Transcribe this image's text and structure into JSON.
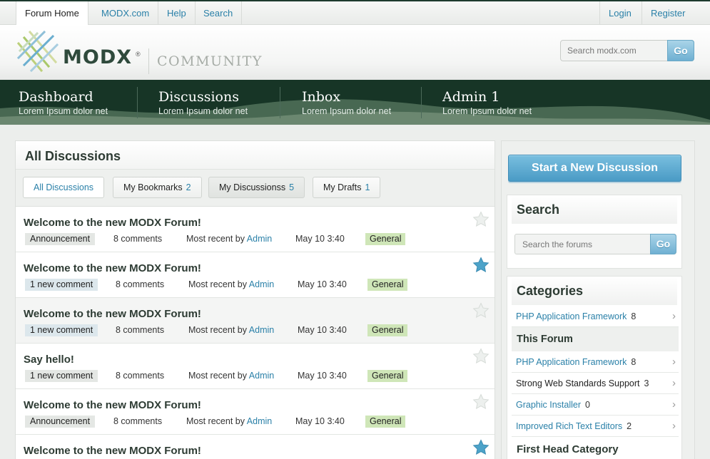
{
  "topbar": {
    "tabs": [
      "Forum Home",
      "MODX.com",
      "Help",
      "Search"
    ],
    "login": "Login",
    "register": "Register"
  },
  "logo": {
    "brand": "MODX",
    "reg": "®",
    "community": "COMMUNITY"
  },
  "header_search": {
    "placeholder": "Search modx.com",
    "go": "Go"
  },
  "nav": [
    {
      "title": "Dashboard",
      "sub": "Lorem Ipsum dolor net"
    },
    {
      "title": "Discussions",
      "sub": "Lorem Ipsum dolor net"
    },
    {
      "title": "Inbox",
      "sub": "Lorem Ipsum dolor net"
    },
    {
      "title": "Admin 1",
      "sub": "Lorem Ipsum dolor net"
    }
  ],
  "main": {
    "title": "All Discussions",
    "filters": [
      {
        "label": "All Discussions",
        "count": ""
      },
      {
        "label": "My Bookmarks",
        "count": "2"
      },
      {
        "label": "My Discussionss",
        "count": "5"
      },
      {
        "label": "My Drafts",
        "count": "1"
      }
    ],
    "rows": [
      {
        "title": "Welcome to the new MODX Forum!",
        "tag": "Announcement",
        "comments": "8 comments",
        "recent": "Most recent by",
        "author": "Admin",
        "date": "May 10 3:40",
        "category": "General",
        "starred": false
      },
      {
        "title": "Welcome to the new MODX Forum!",
        "tag": "1 new comment",
        "comments": "8 comments",
        "recent": "Most recent by",
        "author": "Admin",
        "date": "May 10 3:40",
        "category": "General",
        "starred": true
      },
      {
        "title": "Welcome to the new MODX Forum!",
        "tag": "1 new comment",
        "comments": "8 comments",
        "recent": "Most recent by",
        "author": "Admin",
        "date": "May 10 3:40",
        "category": "General",
        "starred": false
      },
      {
        "title": "Say hello!",
        "tag": "1 new comment",
        "comments": "8 comments",
        "recent": "Most recent by",
        "author": "Admin",
        "date": "May 10 3:40",
        "category": "General",
        "starred": false
      },
      {
        "title": "Welcome to the new MODX Forum!",
        "tag": "Announcement",
        "comments": "8 comments",
        "recent": "Most recent by",
        "author": "Admin",
        "date": "May 10 3:40",
        "category": "General",
        "starred": false
      },
      {
        "title": "Welcome to the new MODX Forum!",
        "tag": "",
        "comments": "",
        "recent": "",
        "author": "",
        "date": "",
        "category": "",
        "starred": true
      }
    ]
  },
  "sidebar": {
    "start_button": "Start a New Discussion",
    "search_title": "Search",
    "search_placeholder": "Search the forums",
    "search_go": "Go",
    "categories_title": "Categories",
    "categories": [
      {
        "label": "PHP Application Framework",
        "count": "8"
      }
    ],
    "this_forum_title": "This Forum",
    "this_forum": [
      {
        "label": "PHP Application Framework",
        "count": "8",
        "link": true
      },
      {
        "label": "Strong Web Standards Support",
        "count": "3",
        "link": false
      },
      {
        "label": "Graphic Installer",
        "count": "0",
        "link": true
      },
      {
        "label": "Improved Rich Text Editors",
        "count": "2",
        "link": true
      }
    ],
    "first_head_title": "First Head Category"
  },
  "colors": {
    "nav_bg": "#173526",
    "link": "#2a80a8",
    "accent_button": "#4a9bc5",
    "category_tag": "#cfe6b8",
    "star_active": "#4da3c9"
  }
}
